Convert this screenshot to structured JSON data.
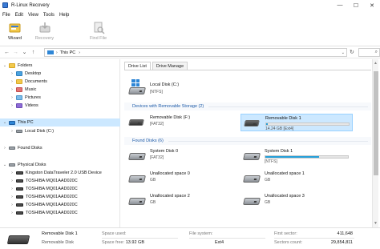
{
  "window": {
    "title": "R-Linux Recovery",
    "controls": [
      "—",
      "☐",
      "✕"
    ]
  },
  "menu": [
    "File",
    "Edit",
    "View",
    "Tools",
    "Help"
  ],
  "toolbar": {
    "wizard": "Wizard",
    "recovery": "Recovery",
    "find_file": "Find File"
  },
  "address": {
    "location": "This PC",
    "search_icon": "⌕"
  },
  "tree": {
    "folders": "Folders",
    "desktop": "Desktop",
    "documents": "Documents",
    "music": "Music",
    "pictures": "Pictures",
    "videos": "Videos",
    "this_pc": "This PC",
    "local_disk": "Local Disk (C:)",
    "found_disks": "Found Disks",
    "physical_disks": "Physical Disks",
    "usb_device": "Kingston DataTraveler 2.0 USB Device",
    "toshiba": [
      "TOSHIBA MQ01AAD020C",
      "TOSHIBA MQ01AAD020C",
      "TOSHIBA MQ01AAD020C",
      "TOSHIBA MQ01AAD020C",
      "TOSHIBA MQ01AAD020C"
    ]
  },
  "tabs": {
    "drive_list": "Drive List",
    "drive_manage": "Drive Manage"
  },
  "sections": {
    "local": "",
    "removable": "Devices with Removable Storage (2)",
    "found": "Found Disks (6)"
  },
  "tiles": {
    "local_disk": {
      "name": "Local Disk (C:)",
      "sub": "[NTFS]"
    },
    "removable_f": {
      "name": "Removable Disk (F:)",
      "sub": "[FAT32]"
    },
    "removable_1": {
      "name": "Removable Disk 1",
      "sub": "14.24 GB [Ext4]",
      "fill": 0.02
    },
    "system_0": {
      "name": "System Disk 0",
      "sub": "[FAT32]"
    },
    "system_1": {
      "name": "System Disk 1",
      "sub": "[NTFS]",
      "fill": 0.65
    },
    "unalloc_0": {
      "name": "Unallocated space 0",
      "sub": "GB"
    },
    "unalloc_1": {
      "name": "Unallocated space 1",
      "sub": "GB"
    },
    "unalloc_2": {
      "name": "Unallocated space 2",
      "sub": "GB"
    },
    "unalloc_3": {
      "name": "Unallocated space 3",
      "sub": "GB"
    }
  },
  "status": {
    "name": "Removable Disk 1",
    "type": "Removable Disk",
    "space_used_label": "Space used:",
    "space_used": "",
    "space_free_label": "Space free:",
    "space_free": "13.92 GB",
    "file_system_label": "File system:",
    "file_system": "Ext4",
    "first_sector_label": "First sector:",
    "first_sector": "411,648",
    "sectors_count_label": "Sectors count:",
    "sectors_count": "29,854,811"
  },
  "colors": {
    "accent": "#26a0da",
    "selection": "#cce8ff",
    "section_text": "#1e5ba8"
  }
}
